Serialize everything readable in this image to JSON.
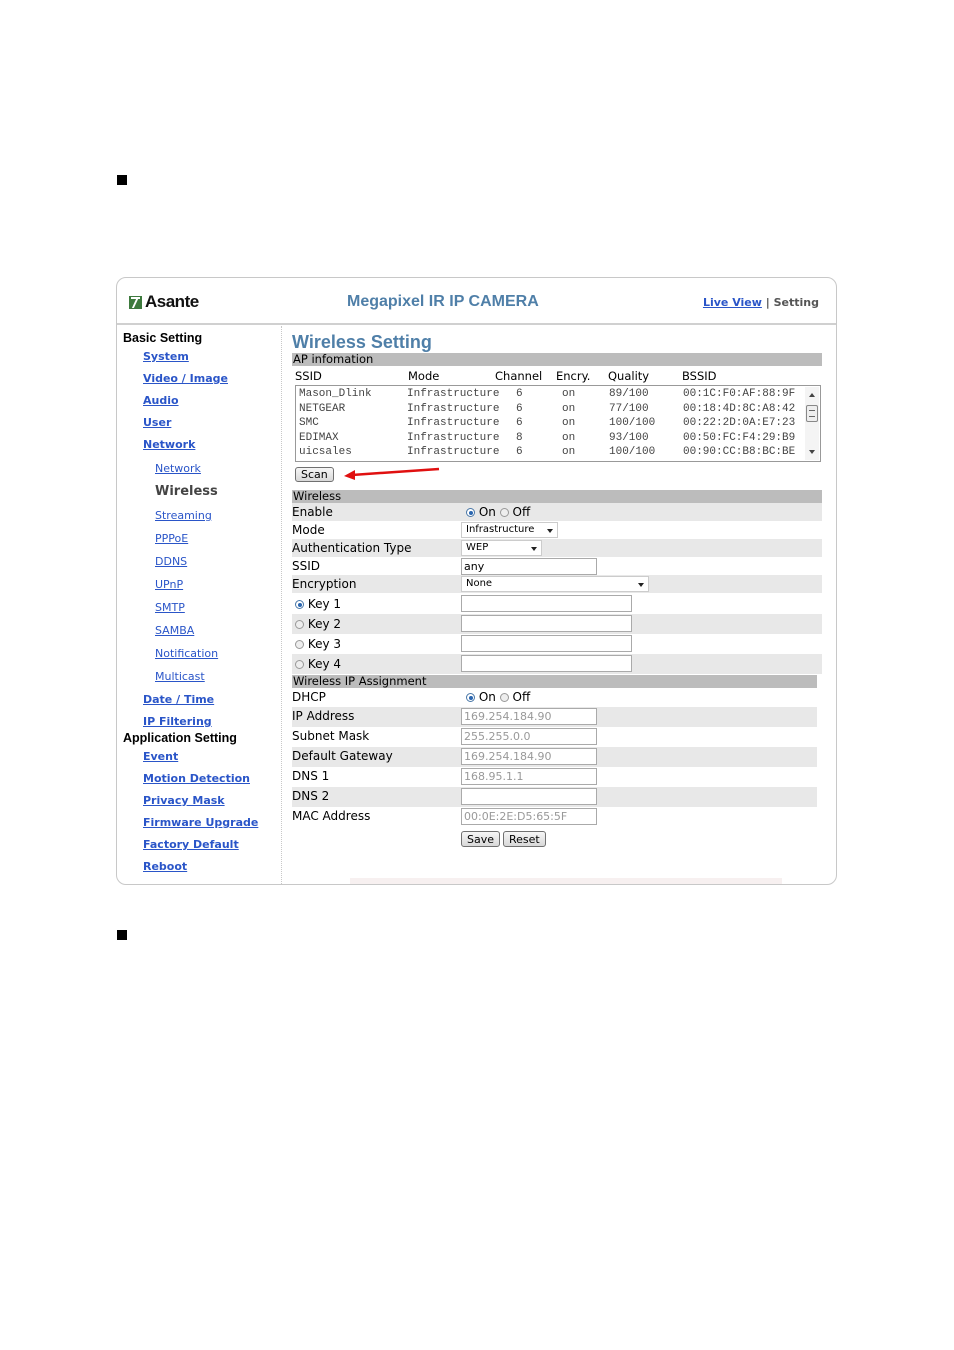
{
  "header": {
    "logo": "Asante",
    "title": "Megapixel IR IP CAMERA",
    "live_view": "Live View",
    "separator": "|",
    "setting": "Setting"
  },
  "sidebar": {
    "basic_heading": "Basic Setting",
    "basic_items": [
      "System",
      "Video / Image",
      "Audio",
      "User",
      "Network"
    ],
    "network_items": [
      "Network",
      "Wireless",
      "Streaming",
      "PPPoE",
      "DDNS",
      "UPnP",
      "SMTP",
      "SAMBA",
      "Notification",
      "Multicast"
    ],
    "basic_items_after": [
      "Date / Time",
      "IP Filtering"
    ],
    "app_heading": "Application Setting",
    "app_items": [
      "Event",
      "Motion Detection",
      "Privacy Mask",
      "Firmware Upgrade",
      "Factory Default",
      "Reboot"
    ],
    "active_item": "Wireless"
  },
  "main": {
    "page_title": "Wireless Setting",
    "ap_section": "AP infomation",
    "ap_columns": [
      "SSID",
      "Mode",
      "Channel",
      "Encry.",
      "Quality",
      "BSSID"
    ],
    "ap_rows": [
      [
        "Mason_Dlink",
        "Infrastructure",
        "6",
        "on",
        "89/100",
        "00:1C:F0:AF:88:9F"
      ],
      [
        "NETGEAR",
        "Infrastructure",
        "6",
        "on",
        "77/100",
        "00:18:4D:8C:A8:42"
      ],
      [
        "SMC",
        "Infrastructure",
        "6",
        "on",
        "100/100",
        "00:22:2D:0A:E7:23"
      ],
      [
        "EDIMAX",
        "Infrastructure",
        "8",
        "on",
        "93/100",
        "00:50:FC:F4:29:B9"
      ],
      [
        "uicsales",
        "Infrastructure",
        "6",
        "on",
        "100/100",
        "00:90:CC:B8:BC:BE"
      ]
    ],
    "scan_button": "Scan",
    "wireless_section": "Wireless",
    "enable_label": "Enable",
    "on_label": "On",
    "off_label": "Off",
    "enable_value": "On",
    "mode_label": "Mode",
    "mode_value": "Infrastructure",
    "auth_label": "Authentication Type",
    "auth_value": "WEP",
    "ssid_label": "SSID",
    "ssid_value": "any",
    "encryption_label": "Encryption",
    "encryption_value": "None",
    "keys": [
      "Key 1",
      "Key 2",
      "Key 3",
      "Key 4"
    ],
    "selected_key": "Key 1",
    "key_values": [
      "",
      "",
      "",
      ""
    ],
    "ip_section": "Wireless IP Assignment",
    "dhcp_label": "DHCP",
    "dhcp_value": "On",
    "ip_label": "IP Address",
    "ip_value": "169.254.184.90",
    "subnet_label": "Subnet Mask",
    "subnet_value": "255.255.0.0",
    "gateway_label": "Default Gateway",
    "gateway_value": "169.254.184.90",
    "dns1_label": "DNS 1",
    "dns1_value": "168.95.1.1",
    "dns2_label": "DNS 2",
    "dns2_value": "",
    "mac_label": "MAC Address",
    "mac_value": "00:0E:2E:D5:65:5F",
    "save_button": "Save",
    "reset_button": "Reset"
  },
  "colors": {
    "title_blue": "#4f7fa8",
    "link_blue": "#2a55c8",
    "section_gray": "#bcbcbc",
    "row_alt": "#e8e8e8",
    "annotation_arrow": "#e01010"
  }
}
